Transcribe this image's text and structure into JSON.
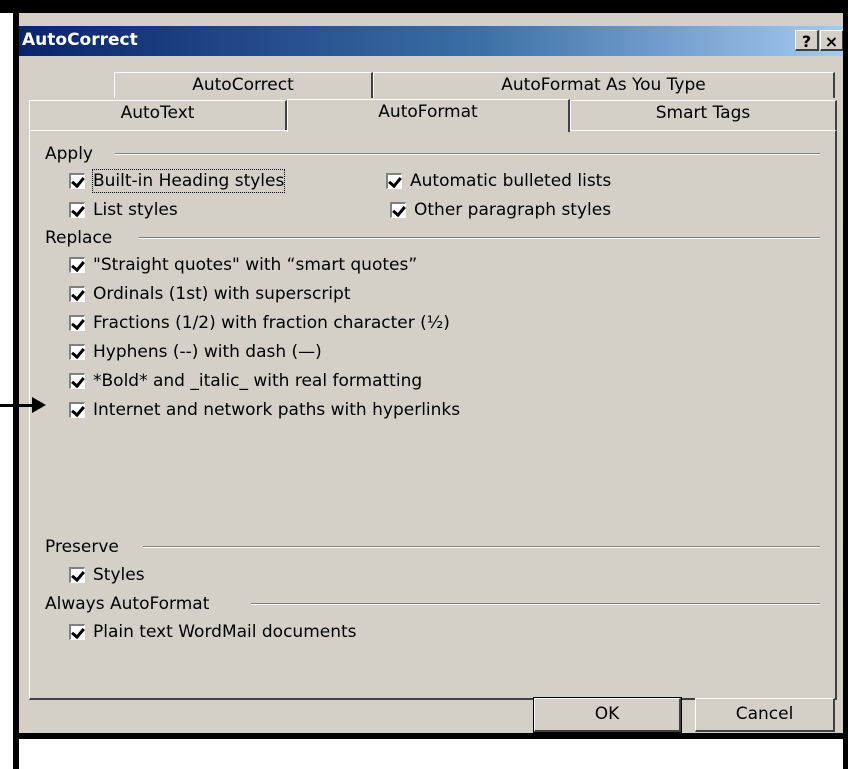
{
  "window": {
    "title": "AutoCorrect",
    "help_label": "?",
    "close_label": "×"
  },
  "tabs_row1": [
    {
      "label": "AutoCorrect"
    },
    {
      "label": "AutoFormat As You Type"
    }
  ],
  "tabs_row2": [
    {
      "label": "AutoText"
    },
    {
      "label": "AutoFormat"
    },
    {
      "label": "Smart Tags"
    }
  ],
  "active_tab": "AutoFormat",
  "groups": {
    "apply": "Apply",
    "replace": "Replace",
    "preserve": "Preserve",
    "always": "Always AutoFormat"
  },
  "options": {
    "heading_styles": {
      "label": "Built-in Heading styles",
      "checked": true
    },
    "auto_bullets": {
      "label": "Automatic bulleted lists",
      "checked": true
    },
    "list_styles": {
      "label": "List styles",
      "checked": true
    },
    "other_para": {
      "label": "Other paragraph styles",
      "checked": true
    },
    "smart_quotes": {
      "label": "\"Straight quotes\" with “smart quotes”",
      "checked": true
    },
    "ordinals": {
      "label": "Ordinals (1st) with superscript",
      "checked": true
    },
    "fractions": {
      "label": "Fractions (1/2) with fraction character (½)",
      "checked": true
    },
    "hyphens": {
      "label": "Hyphens (--) with dash (—)",
      "checked": true
    },
    "bold_italic": {
      "label": "*Bold* and _italic_ with real formatting",
      "checked": true
    },
    "hyperlinks": {
      "label": "Internet and network paths with hyperlinks",
      "checked": true
    },
    "styles": {
      "label": "Styles",
      "checked": true
    },
    "wordmail": {
      "label": "Plain text WordMail documents",
      "checked": true
    }
  },
  "buttons": {
    "ok": "OK",
    "cancel": "Cancel"
  }
}
